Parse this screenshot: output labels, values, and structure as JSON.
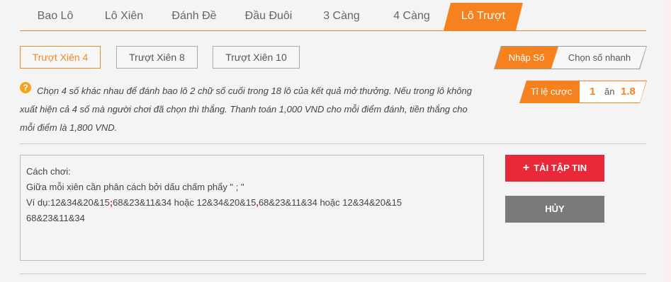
{
  "tabs": [
    {
      "label": "Bao Lô"
    },
    {
      "label": "Lô Xiên"
    },
    {
      "label": "Đánh Đề"
    },
    {
      "label": "Đầu Đuôi"
    },
    {
      "label": "3 Càng"
    },
    {
      "label": "4 Càng"
    },
    {
      "label": "Lô Trượt",
      "active": true
    }
  ],
  "subtabs": [
    {
      "label": "Trượt Xiên 4",
      "active": true
    },
    {
      "label": "Trượt Xiên 8"
    },
    {
      "label": "Trượt Xiên 10"
    }
  ],
  "mode": {
    "active_label": "Nhập Số",
    "inactive_label": "Chọn số nhanh"
  },
  "odds": {
    "label": "Tỉ lệ cược",
    "left": "1",
    "middle": "ăn",
    "right": "1.8"
  },
  "description": {
    "icon": "?",
    "text": "Chọn 4 số khác nhau để đánh bao lô 2 chữ số cuối trong 18 lô của kết quả mở thưởng. Nếu trong lô không xuất hiện cả 4 số mà người chơi đã chọn thì thắng. Thanh toán 1,000 VND cho mỗi điểm đánh, tiền thắng cho mỗi điểm là 1,800 VND."
  },
  "instructions": {
    "line1": "Cách chơi:",
    "line2": "Giữa mỗi xiên cần phân cách bởi dấu chấm phẩy \" ; \"",
    "line3_a": "Ví dụ:12&34&20&15",
    "line3_sep1": ";",
    "line3_b": "68&23&11&34 hoặc 12&34&20&15",
    "line3_sep2": ",",
    "line3_c": "68&23&11&34 hoặc 12&34&20&15",
    "line4": "68&23&11&34"
  },
  "buttons": {
    "upload_label": "TẢI TẬP TIN",
    "cancel_label": "HỦY"
  },
  "colors": {
    "accent": "#f5821f",
    "upload": "#e9283a",
    "cancel": "#7a7a7a"
  }
}
